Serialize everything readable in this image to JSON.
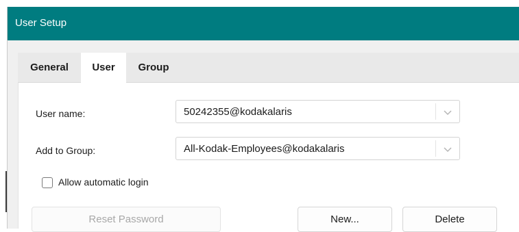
{
  "window": {
    "title": "User Setup"
  },
  "tabs": [
    {
      "label": "General",
      "selected": false
    },
    {
      "label": "User",
      "selected": true
    },
    {
      "label": "Group",
      "selected": false
    }
  ],
  "form": {
    "user_name_label": "User name:",
    "user_name_value": "50242355@kodakalaris",
    "add_group_label": "Add to Group:",
    "add_group_value": "All-Kodak-Employees@kodakalaris",
    "auto_login_label": "Allow automatic login",
    "auto_login_checked": false
  },
  "buttons": {
    "reset_password": "Reset Password",
    "new": "New...",
    "delete": "Delete"
  },
  "colors": {
    "titlebar": "#007c80"
  },
  "icons": {
    "dropdown": "chevron-down-icon"
  }
}
